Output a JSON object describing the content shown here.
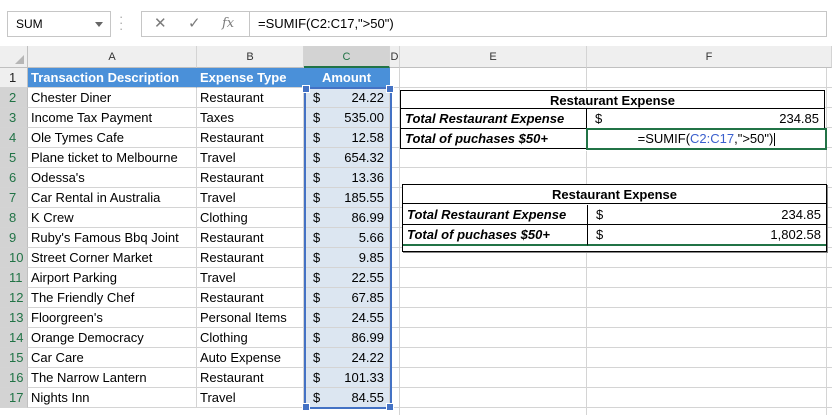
{
  "formula_bar": {
    "name_box": "SUM",
    "formula": "=SUMIF(C2:C17,\">50\")",
    "cancel_icon": "✕",
    "enter_icon": "✓",
    "fx_label": "fx"
  },
  "columns": [
    "A",
    "B",
    "C",
    "D",
    "E",
    "F"
  ],
  "rows": [
    "1",
    "2",
    "3",
    "4",
    "5",
    "6",
    "7",
    "8",
    "9",
    "10",
    "11",
    "12",
    "13",
    "14",
    "15",
    "16",
    "17"
  ],
  "headers": {
    "description": "Transaction Description",
    "type": "Expense Type",
    "amount": "Amount"
  },
  "transactions": [
    {
      "desc": "Chester Diner",
      "type": "Restaurant",
      "cur": "$",
      "amount": "24.22"
    },
    {
      "desc": "Income Tax Payment",
      "type": "Taxes",
      "cur": "$",
      "amount": "535.00"
    },
    {
      "desc": "Ole Tymes Cafe",
      "type": "Restaurant",
      "cur": "$",
      "amount": "12.58"
    },
    {
      "desc": "Plane ticket to Melbourne",
      "type": "Travel",
      "cur": "$",
      "amount": "654.32"
    },
    {
      "desc": "Odessa's",
      "type": "Restaurant",
      "cur": "$",
      "amount": "13.36"
    },
    {
      "desc": "Car Rental in Australia",
      "type": "Travel",
      "cur": "$",
      "amount": "185.55"
    },
    {
      "desc": "K Crew",
      "type": "Clothing",
      "cur": "$",
      "amount": "86.99"
    },
    {
      "desc": "Ruby's Famous Bbq Joint",
      "type": "Restaurant",
      "cur": "$",
      "amount": "5.66"
    },
    {
      "desc": "Street Corner Market",
      "type": "Restaurant",
      "cur": "$",
      "amount": "9.85"
    },
    {
      "desc": "Airport Parking",
      "type": "Travel",
      "cur": "$",
      "amount": "22.55"
    },
    {
      "desc": "The Friendly Chef",
      "type": "Restaurant",
      "cur": "$",
      "amount": "67.85"
    },
    {
      "desc": "Floorgreen's",
      "type": "Personal Items",
      "cur": "$",
      "amount": "24.55"
    },
    {
      "desc": "Orange Democracy",
      "type": "Clothing",
      "cur": "$",
      "amount": "86.99"
    },
    {
      "desc": "Car Care",
      "type": "Auto Expense",
      "cur": "$",
      "amount": "24.22"
    },
    {
      "desc": "The Narrow Lantern",
      "type": "Restaurant",
      "cur": "$",
      "amount": "101.33"
    },
    {
      "desc": "Nights Inn",
      "type": "Travel",
      "cur": "$",
      "amount": "84.55"
    }
  ],
  "summary_editing": {
    "title": "Restaurant Expense",
    "row1_label": "Total Restaurant Expense",
    "row1_cur": "$",
    "row1_value": "234.85",
    "row2_label": "Total of puchases $50+",
    "formula_prefix": "=SUMIF(",
    "formula_ref": "C2:C17",
    "formula_suffix": ",\">50\")"
  },
  "summary_result": {
    "title": "Restaurant Expense",
    "row1_label": "Total Restaurant Expense",
    "row1_cur": "$",
    "row1_value": "234.85",
    "row2_label": "Total of puchases $50+",
    "row2_cur": "$",
    "row2_value": "1,802.58"
  },
  "colors": {
    "header_fill": "#4a90d9",
    "amount_fill": "#dce6f1",
    "selection": "#4472c4",
    "active_cell": "#217346"
  }
}
